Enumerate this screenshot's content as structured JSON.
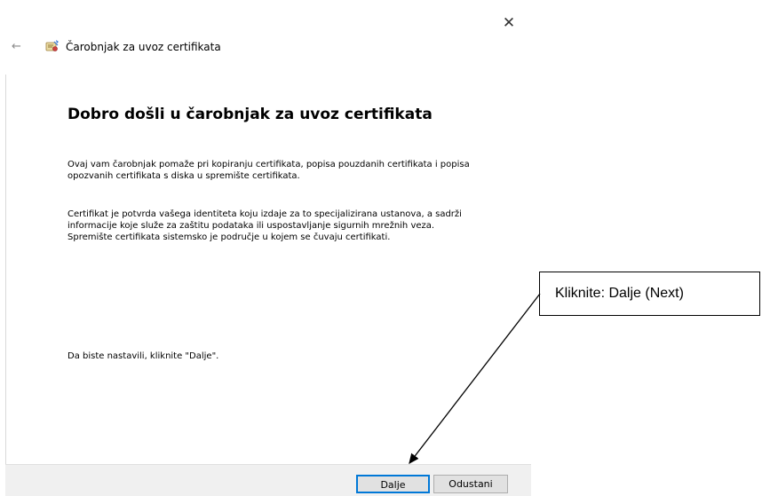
{
  "window": {
    "title": "Čarobnjak za uvoz certifikata",
    "close_glyph": "✕",
    "back_glyph": "←"
  },
  "content": {
    "heading": "Dobro došli u čarobnjak za uvoz certifikata",
    "paragraph1_line1": "Ovaj vam čarobnjak pomaže pri kopiranju certifikata, popisa pouzdanih certifikata i popisa",
    "paragraph1_line2": "opozvanih certifikata s diska u spremište certifikata.",
    "paragraph2_line1": "Certifikat je potvrda vašega identiteta koju izdaje za to specijalizirana ustanova, a sadrži",
    "paragraph2_line2": "informacije koje služe za zaštitu podataka ili uspostavljanje sigurnih mrežnih veza.",
    "paragraph2_line3": "Spremište certifikata sistemsko je područje u kojem se čuvaju certifikati.",
    "paragraph3": "Da biste nastavili, kliknite \"Dalje\"."
  },
  "footer": {
    "next_label": "Dalje",
    "cancel_label": "Odustani"
  },
  "annotation": {
    "callout_text": "Kliknite: Dalje (Next)"
  },
  "colors": {
    "focus_border": "#0078d7",
    "footer_bg": "#f0f0f0"
  },
  "icons": {
    "app": "certificate-wizard-icon"
  }
}
